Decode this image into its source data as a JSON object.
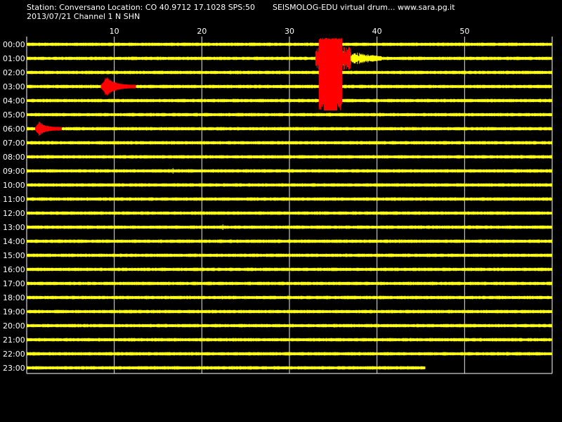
{
  "header": {
    "station_line": "Station: Conversano Location: CO 40.9712 17.1028 SPS:50",
    "site_line": "SEISMOLOG-EDU virtual drum... www.sara.pg.it",
    "date_channel_line": "2013/07/21  Channel 1 N SHN"
  },
  "chart_data": {
    "type": "line",
    "x_ticks": [
      10,
      20,
      30,
      40,
      50
    ],
    "xlim": [
      0,
      60
    ],
    "grid": true,
    "hours": [
      "00:00",
      "01:00",
      "02:00",
      "03:00",
      "04:00",
      "05:00",
      "06:00",
      "07:00",
      "08:00",
      "09:00",
      "10:00",
      "11:00",
      "12:00",
      "13:00",
      "14:00",
      "15:00",
      "16:00",
      "17:00",
      "18:00",
      "19:00",
      "20:00",
      "21:00",
      "22:00",
      "23:00"
    ],
    "last_trace_end_minute": 45.5,
    "events": [
      {
        "hour": "03:00",
        "start_minute": 8.5,
        "end_minute": 12.5,
        "color": "#ff0000"
      },
      {
        "hour": "06:00",
        "start_minute": 1.0,
        "end_minute": 4.0,
        "color": "#ff0000"
      },
      {
        "hour": "00:00",
        "start_minute": 33.0,
        "end_minute": 36.5,
        "color": "#ff0000"
      },
      {
        "hour": "01:00",
        "start_minute": 33.0,
        "end_minute": 40.0,
        "color": "#ff0000"
      }
    ],
    "trace_color": "#ffff00",
    "event_color": "#ff0000",
    "grid_color": "#ffffff"
  }
}
